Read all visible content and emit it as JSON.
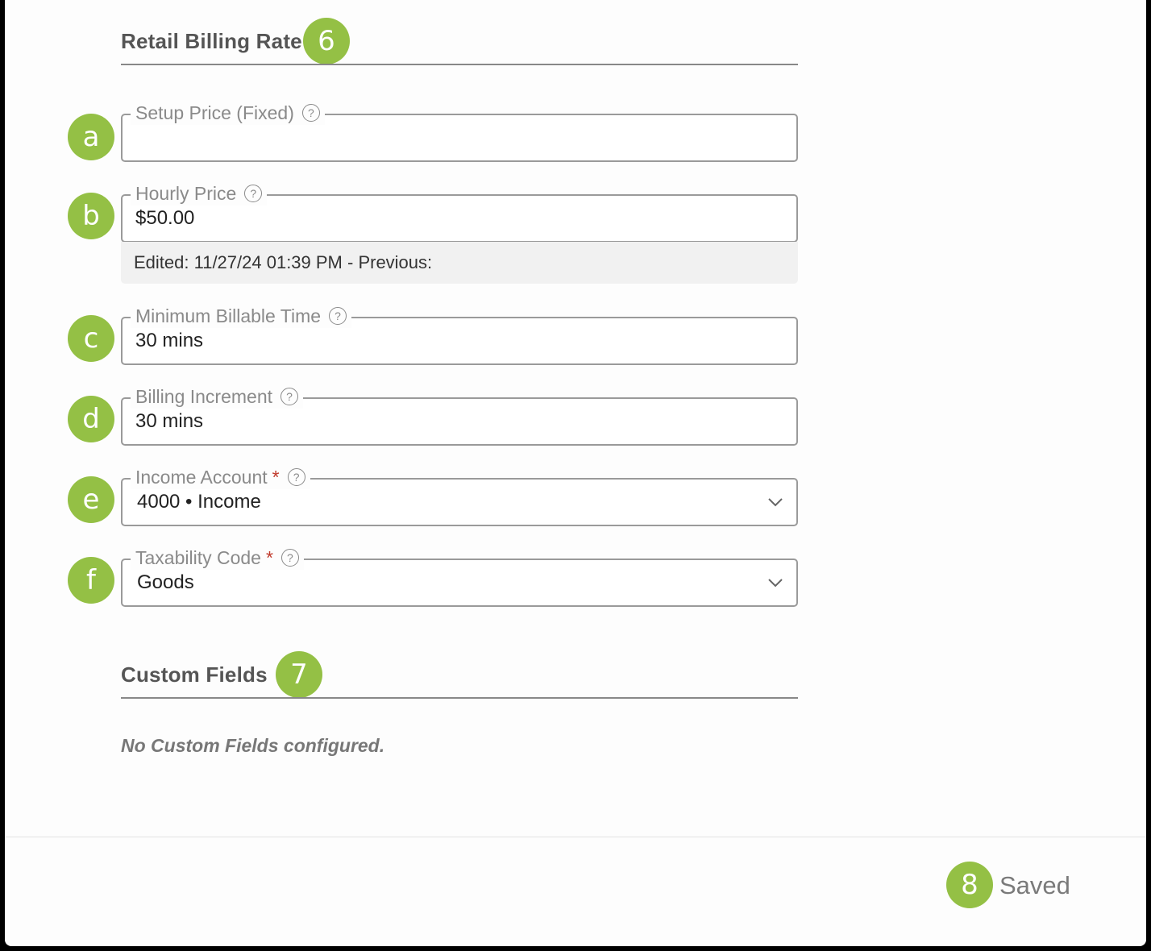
{
  "sections": {
    "billing": {
      "title": "Retail Billing Rate",
      "badge": "6"
    },
    "custom": {
      "title": "Custom Fields",
      "badge": "7",
      "empty_message": "No Custom Fields configured."
    }
  },
  "fields": {
    "setup_price": {
      "badge": "a",
      "label": "Setup Price (Fixed)",
      "value": "",
      "help": "?"
    },
    "hourly_price": {
      "badge": "b",
      "label": "Hourly Price",
      "value": "$50.00",
      "help": "?",
      "edit_note": "Edited: 11/27/24 01:39 PM - Previous:"
    },
    "min_billable": {
      "badge": "c",
      "label": "Minimum Billable Time",
      "value": "30 mins",
      "help": "?"
    },
    "billing_increment": {
      "badge": "d",
      "label": "Billing Increment",
      "value": "30 mins",
      "help": "?"
    },
    "income_account": {
      "badge": "e",
      "label": "Income Account",
      "required": "*",
      "value": "4000 • Income",
      "help": "?"
    },
    "taxability_code": {
      "badge": "f",
      "label": "Taxability Code",
      "required": "*",
      "value": "Goods",
      "help": "?"
    }
  },
  "footer": {
    "badge": "8",
    "status": "Saved"
  },
  "colors": {
    "badge": "#94c045",
    "required": "#c0392b",
    "border": "#9a9a9a"
  },
  "icons": {
    "help": "question-circle-icon",
    "dropdown": "chevron-down-icon"
  }
}
